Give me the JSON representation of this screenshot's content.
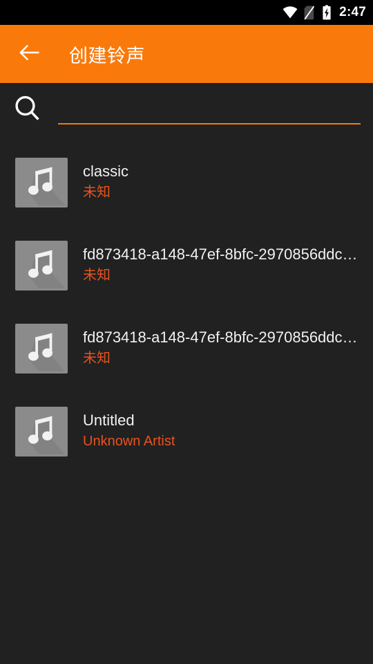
{
  "status_bar": {
    "time": "2:47",
    "icons": [
      {
        "name": "wifi-icon",
        "label": "wifi"
      },
      {
        "name": "sim-card-missing-icon",
        "label": "no-sim"
      },
      {
        "name": "battery-charging-icon",
        "label": "battery-charging"
      }
    ]
  },
  "app_bar": {
    "back_icon": "arrow-back-icon",
    "title": "创建铃声",
    "background_color": "#f97a0b",
    "title_color": "#ffffff"
  },
  "search": {
    "icon": "search-icon",
    "value": "",
    "placeholder": "",
    "underline_color": "#f97a0b"
  },
  "theme": {
    "background": "#212121",
    "accent": "#f97a0b",
    "subtitle_color": "#e8521e",
    "title_color": "#f1f1f1",
    "thumb_color": "#8b8b8b"
  },
  "song_list": {
    "items": [
      {
        "title": "classic",
        "artist": "未知",
        "thumb_icon": "music-note-icon"
      },
      {
        "title": "fd873418-a148-47ef-8bfc-2970856ddc…",
        "artist": "未知",
        "thumb_icon": "music-note-icon"
      },
      {
        "title": "fd873418-a148-47ef-8bfc-2970856ddc…",
        "artist": "未知",
        "thumb_icon": "music-note-icon"
      },
      {
        "title": "Untitled",
        "artist": "Unknown Artist",
        "thumb_icon": "music-note-icon"
      }
    ]
  }
}
